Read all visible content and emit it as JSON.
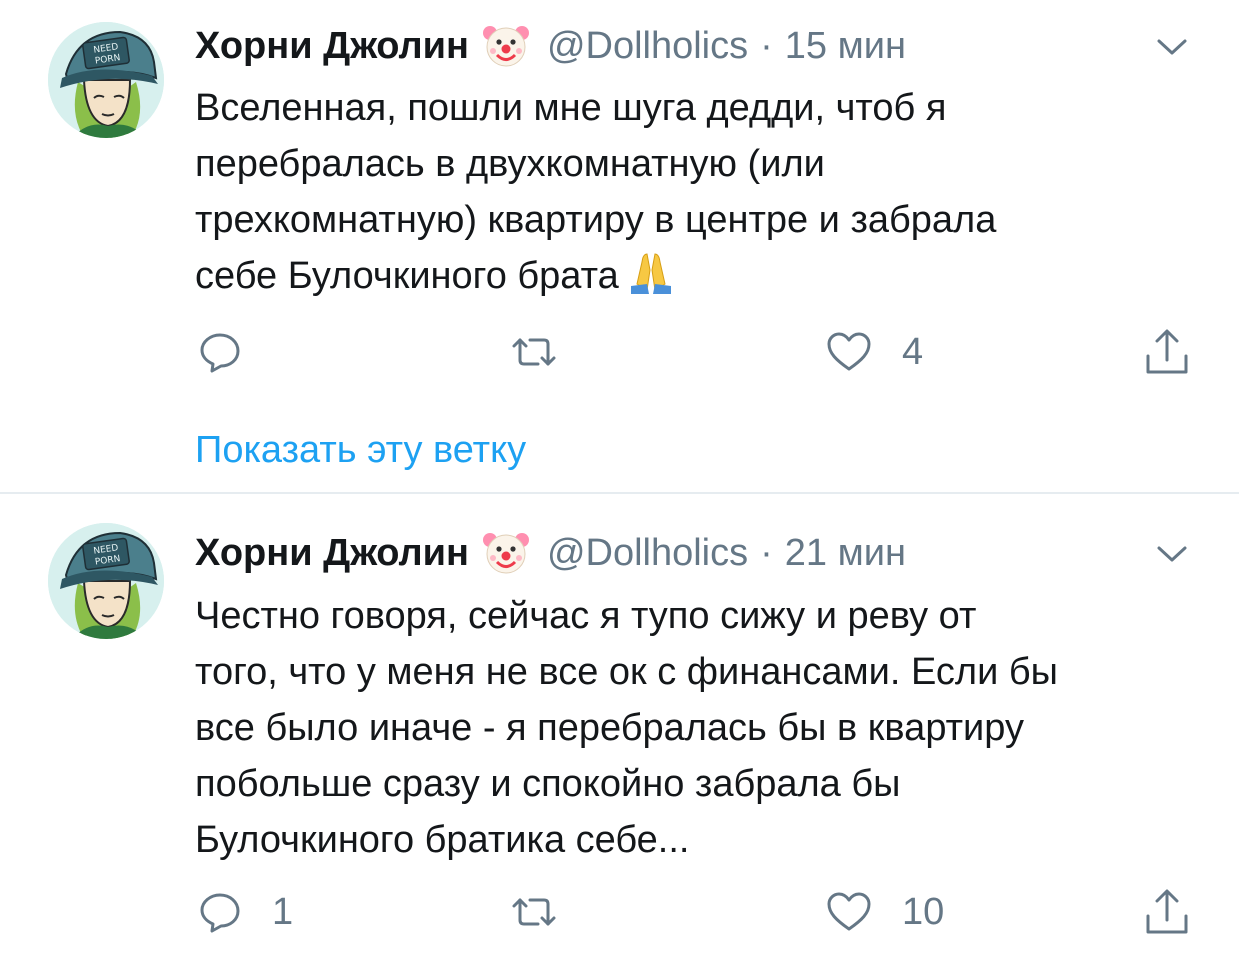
{
  "tweets": [
    {
      "author": {
        "display_name": "Хорни Джолин",
        "name_emoji": "clown-face-icon",
        "handle": "@Dollholics"
      },
      "separator": "·",
      "time": "15 мин",
      "text_lines": [
        "Вселенная, пошли мне шуга дедди, чтоб я",
        "перебралась в двухкомнатную (или",
        "трехкомнатную)  квартиру в центре и забрала",
        "себе Булочкиного брата"
      ],
      "trailing_emoji": "folded-hands-icon",
      "actions": {
        "reply_count": "",
        "retweet_count": "",
        "like_count": "4"
      },
      "show_thread_link": "Показать эту ветку"
    },
    {
      "author": {
        "display_name": "Хорни Джолин",
        "name_emoji": "clown-face-icon",
        "handle": "@Dollholics"
      },
      "separator": "·",
      "time": "21 мин",
      "text_lines": [
        "Честно говоря, сейчас я тупо сижу и реву от",
        "того, что у меня не все ок с финансами. Если бы",
        "все было иначе - я перебралась бы в квартиру",
        "побольше сразу и спокойно забрала бы",
        "Булочкиного братика себе..."
      ],
      "actions": {
        "reply_count": "1",
        "retweet_count": "",
        "like_count": "10"
      }
    }
  ],
  "colors": {
    "text_primary": "#14171a",
    "text_secondary": "#657786",
    "link_blue": "#1da1f2",
    "divider": "#e6ecf0"
  }
}
